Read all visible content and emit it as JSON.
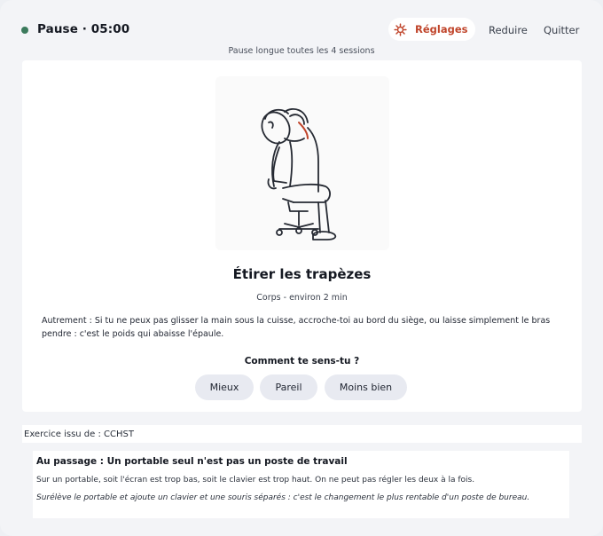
{
  "header": {
    "status_color": "#3b7a5c",
    "title": "Pause · 05:00",
    "settings_label": "Réglages",
    "settings_icon": "gear-icon",
    "reduce_label": "Reduire",
    "quit_label": "Quitter",
    "subtitle": "Pause longue toutes les 4 sessions"
  },
  "accent_color": "#c0452b",
  "exercise": {
    "illustration": "person-stretching-neck-on-chair",
    "title": "Étirer les trapèzes",
    "meta": "Corps - environ 2 min",
    "description": "Autrement : Si tu ne peux pas glisser la main sous la cuisse, accroche-toi au bord du siège, ou laisse simplement le bras pendre : c'est le poids qui abaisse l'épaule.",
    "feel_question": "Comment te sens-tu ?",
    "feel_options": [
      "Mieux",
      "Pareil",
      "Moins bien"
    ]
  },
  "source": "Exercice issu de : CCHST",
  "tip": {
    "title": "Au passage : Un portable seul n'est pas un poste de travail",
    "body": "Sur un portable, soit l'écran est trop bas, soit le clavier est trop haut. On ne peut pas régler les deux à la fois.",
    "advice": "Surélève le portable et ajoute un clavier et une souris séparés : c'est le changement le plus rentable d'un poste de bureau."
  }
}
